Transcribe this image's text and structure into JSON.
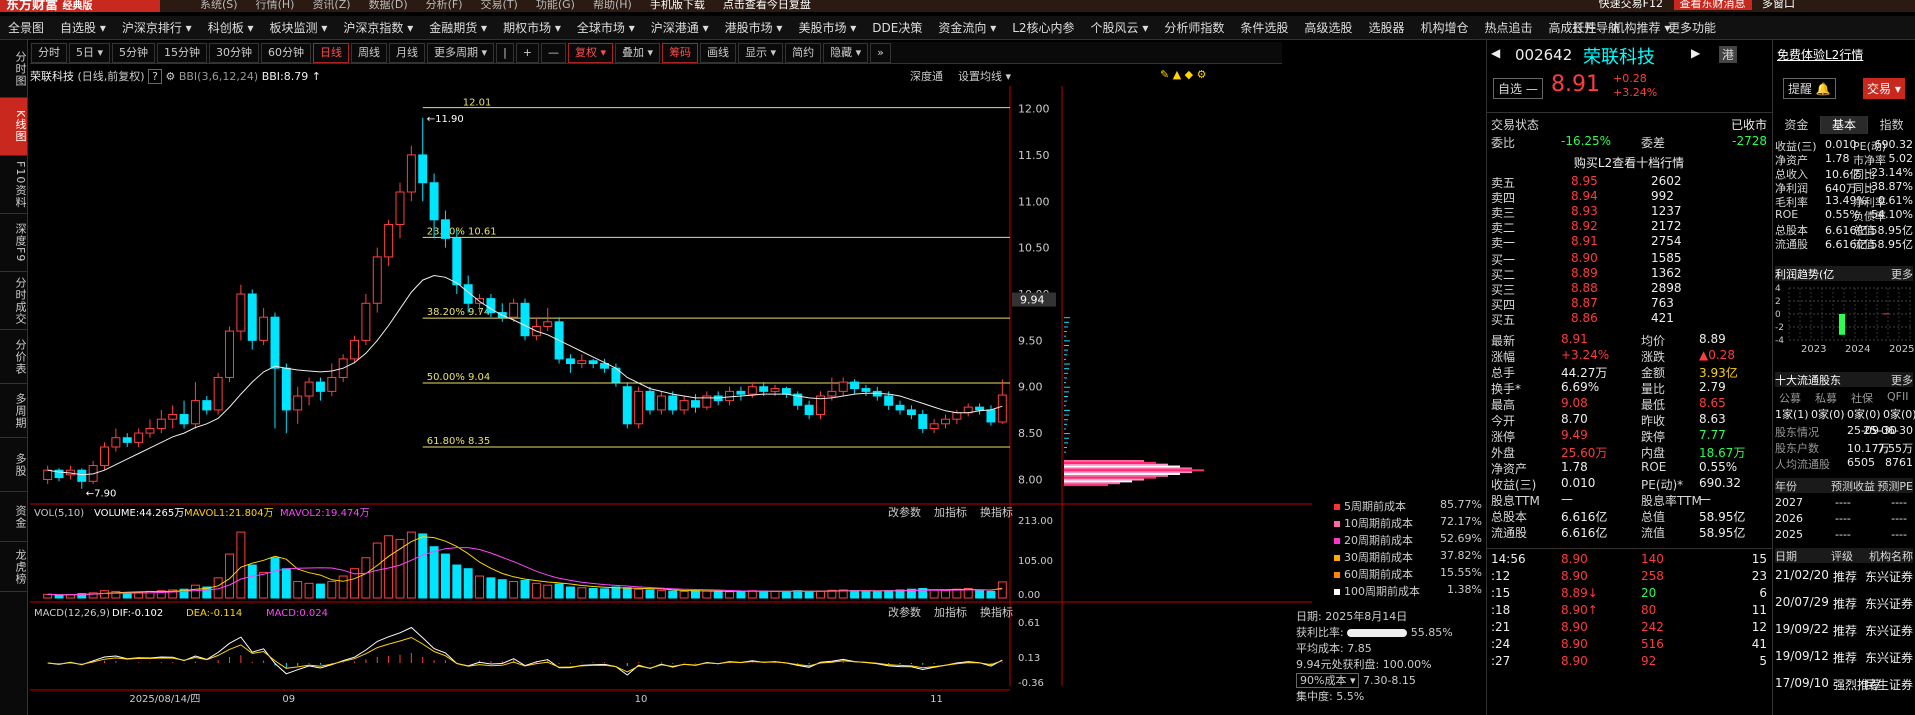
{
  "app": {
    "logo": "东方财富",
    "logo_sub": "经典版",
    "menu": [
      "系统(S)",
      "行情(H)",
      "资讯(Z)",
      "数据(D)",
      "分析(F)",
      "交易(T)",
      "功能(G)",
      "帮助(H)"
    ],
    "ad1": "手机版下载",
    "ad2": "点击查看今日复盘",
    "ad3": "快速交易F12",
    "right": "查看东财消息",
    "right2": "多窗口"
  },
  "nav": {
    "items": [
      "全景图",
      "自选股 ▾",
      "沪深京排行 ▾",
      "科创板 ▾",
      "板块监测 ▾",
      "沪深京指数 ▾",
      "金融期货 ▾",
      "期权市场 ▾",
      "全球市场 ▾",
      "沪深港通 ▾",
      "港股市场 ▾",
      "美股市场 ▾",
      "DDE决策",
      "资金流向 ▾",
      "L2核心内参",
      "个股风云 ▾",
      "分析师指数",
      "条件选股",
      "高级选股",
      "选股器",
      "机构增仓",
      "热点追击",
      "高成长性",
      "机构推荐 ▾",
      "打开导航",
      "更多功能"
    ]
  },
  "side": [
    "分时图",
    "K线图",
    "F10资料",
    "深度F9",
    "分时成交",
    "分价表",
    "多周期",
    "多股",
    "资金",
    "龙虎榜"
  ],
  "toolbar": [
    "分时",
    "5日 ▾",
    "5分钟",
    "15分钟",
    "30分钟",
    "60分钟",
    "日线",
    "周线",
    "月线",
    "更多周期 ▾",
    "|",
    "+",
    "—",
    "复权 ▾",
    "叠加 ▾",
    "筹码",
    "画线",
    "显示 ▾",
    "简约",
    "隐藏 ▾",
    "»"
  ],
  "header": {
    "name": "荣联科技",
    "mode": "(日线,前复权)",
    "help": "?",
    "bbi": "BBI(3,6,12,24)",
    "bbi_val": "BBI:8.79",
    "arrow": "↑",
    "deep": "深度通",
    "settings": "设置均线 ▾"
  },
  "chart_data": {
    "type": "candlestick",
    "ylim": [
      7.8,
      12.2
    ],
    "yticks": [
      "12.00",
      "11.50",
      "11.00",
      "10.50",
      "10.00",
      "9.50",
      "9.00",
      "8.50",
      "8.00"
    ],
    "price_tag": "9.94",
    "fib": [
      {
        "label": "23.60% 10.61",
        "v": 10.61
      },
      {
        "label": "38.20% 9.74",
        "v": 9.74
      },
      {
        "label": "50.00% 9.04",
        "v": 9.04
      },
      {
        "label": "61.80% 8.35",
        "v": 8.35
      }
    ],
    "top_label": "12.01",
    "high_mark": "←11.90",
    "low_mark": "←7.90",
    "candles": [
      [
        8.0,
        8.1,
        7.95,
        8.15
      ],
      [
        8.1,
        8.02,
        7.98,
        8.12
      ],
      [
        8.05,
        8.1,
        8.0,
        8.15
      ],
      [
        8.1,
        7.98,
        7.9,
        8.12
      ],
      [
        7.98,
        8.15,
        7.95,
        8.2
      ],
      [
        8.15,
        8.35,
        8.1,
        8.4
      ],
      [
        8.35,
        8.45,
        8.3,
        8.55
      ],
      [
        8.45,
        8.4,
        8.35,
        8.5
      ],
      [
        8.4,
        8.5,
        8.35,
        8.55
      ],
      [
        8.5,
        8.55,
        8.45,
        8.65
      ],
      [
        8.55,
        8.65,
        8.5,
        8.75
      ],
      [
        8.65,
        8.7,
        8.55,
        8.8
      ],
      [
        8.7,
        8.6,
        8.55,
        8.85
      ],
      [
        8.6,
        8.85,
        8.55,
        9.05
      ],
      [
        8.85,
        8.75,
        8.7,
        8.9
      ],
      [
        8.75,
        9.1,
        8.7,
        9.15
      ],
      [
        9.1,
        9.6,
        9.05,
        9.65
      ],
      [
        9.6,
        10.0,
        9.5,
        10.1
      ],
      [
        10.0,
        9.5,
        9.4,
        10.05
      ],
      [
        9.5,
        9.75,
        9.45,
        9.85
      ],
      [
        9.75,
        9.2,
        8.55,
        9.8
      ],
      [
        9.2,
        8.75,
        8.5,
        9.25
      ],
      [
        8.75,
        8.9,
        8.6,
        9.0
      ],
      [
        8.9,
        9.05,
        8.8,
        9.1
      ],
      [
        9.05,
        8.95,
        8.85,
        9.1
      ],
      [
        8.95,
        9.1,
        8.9,
        9.25
      ],
      [
        9.1,
        9.3,
        9.05,
        9.35
      ],
      [
        9.3,
        9.5,
        9.25,
        9.55
      ],
      [
        9.5,
        9.9,
        9.45,
        10.0
      ],
      [
        9.9,
        10.4,
        9.8,
        10.5
      ],
      [
        10.4,
        10.75,
        10.3,
        10.8
      ],
      [
        10.75,
        11.1,
        10.6,
        11.2
      ],
      [
        11.1,
        11.5,
        11.0,
        11.6
      ],
      [
        11.5,
        11.2,
        11.0,
        11.9
      ],
      [
        11.2,
        10.8,
        10.6,
        11.3
      ],
      [
        10.8,
        10.6,
        10.5,
        10.9
      ],
      [
        10.6,
        10.1,
        10.0,
        10.7
      ],
      [
        10.1,
        9.9,
        9.8,
        10.2
      ],
      [
        9.9,
        9.95,
        9.8,
        10.0
      ],
      [
        9.95,
        9.8,
        9.75,
        10.0
      ],
      [
        9.8,
        9.75,
        9.7,
        9.9
      ],
      [
        9.75,
        9.9,
        9.7,
        9.95
      ],
      [
        9.9,
        9.55,
        9.5,
        9.95
      ],
      [
        9.55,
        9.65,
        9.5,
        9.75
      ],
      [
        9.65,
        9.7,
        9.6,
        9.85
      ],
      [
        9.7,
        9.3,
        9.25,
        9.75
      ],
      [
        9.3,
        9.25,
        9.15,
        9.35
      ],
      [
        9.25,
        9.28,
        9.2,
        9.35
      ],
      [
        9.28,
        9.25,
        9.2,
        9.3
      ],
      [
        9.25,
        9.2,
        9.15,
        9.3
      ],
      [
        9.2,
        9.05,
        9.0,
        9.25
      ],
      [
        9.0,
        8.6,
        8.55,
        9.05
      ],
      [
        8.6,
        8.95,
        8.55,
        9.0
      ],
      [
        8.95,
        8.75,
        8.7,
        9.0
      ],
      [
        8.75,
        8.9,
        8.7,
        8.95
      ],
      [
        8.9,
        8.75,
        8.7,
        8.95
      ],
      [
        8.75,
        8.85,
        8.7,
        8.9
      ],
      [
        8.85,
        8.78,
        8.72,
        8.92
      ],
      [
        8.78,
        8.9,
        8.75,
        8.95
      ],
      [
        8.9,
        8.85,
        8.8,
        8.95
      ],
      [
        8.85,
        8.95,
        8.8,
        9.0
      ],
      [
        8.95,
        8.92,
        8.85,
        9.0
      ],
      [
        8.92,
        9.0,
        8.88,
        9.05
      ],
      [
        9.0,
        8.95,
        8.9,
        9.05
      ],
      [
        8.95,
        8.98,
        8.9,
        9.02
      ],
      [
        8.98,
        8.92,
        8.88,
        9.0
      ],
      [
        8.92,
        8.8,
        8.75,
        8.95
      ],
      [
        8.8,
        8.7,
        8.65,
        8.85
      ],
      [
        8.7,
        8.9,
        8.65,
        8.95
      ],
      [
        8.9,
        8.95,
        8.85,
        9.1
      ],
      [
        8.95,
        9.05,
        8.9,
        9.1
      ],
      [
        9.05,
        8.98,
        8.92,
        9.08
      ],
      [
        8.98,
        8.95,
        8.9,
        9.02
      ],
      [
        8.95,
        8.9,
        8.85,
        9.0
      ],
      [
        8.9,
        8.8,
        8.75,
        8.95
      ],
      [
        8.8,
        8.75,
        8.7,
        8.85
      ],
      [
        8.75,
        8.7,
        8.65,
        8.8
      ],
      [
        8.7,
        8.55,
        8.5,
        8.75
      ],
      [
        8.55,
        8.6,
        8.5,
        8.65
      ],
      [
        8.6,
        8.65,
        8.55,
        8.7
      ],
      [
        8.65,
        8.72,
        8.6,
        8.75
      ],
      [
        8.72,
        8.78,
        8.68,
        8.82
      ],
      [
        8.78,
        8.75,
        8.7,
        8.82
      ],
      [
        8.75,
        8.62,
        8.58,
        8.8
      ],
      [
        8.62,
        8.91,
        8.6,
        9.08
      ]
    ],
    "bbi": [
      8.1,
      8.08,
      8.07,
      8.05,
      8.06,
      8.1,
      8.16,
      8.22,
      8.28,
      8.34,
      8.4,
      8.46,
      8.5,
      8.56,
      8.6,
      8.66,
      8.78,
      8.92,
      9.05,
      9.16,
      9.22,
      9.2,
      9.18,
      9.17,
      9.16,
      9.17,
      9.2,
      9.26,
      9.36,
      9.5,
      9.66,
      9.84,
      10.02,
      10.15,
      10.2,
      10.18,
      10.12,
      10.02,
      9.92,
      9.84,
      9.77,
      9.72,
      9.66,
      9.6,
      9.56,
      9.5,
      9.44,
      9.38,
      9.32,
      9.26,
      9.2,
      9.1,
      9.04,
      8.98,
      8.95,
      8.92,
      8.9,
      8.88,
      8.88,
      8.88,
      8.89,
      8.9,
      8.91,
      8.92,
      8.92,
      8.92,
      8.9,
      8.88,
      8.87,
      8.88,
      8.9,
      8.92,
      8.93,
      8.93,
      8.92,
      8.9,
      8.86,
      8.82,
      8.78,
      8.74,
      8.72,
      8.72,
      8.74,
      8.75,
      8.79
    ],
    "vol": {
      "title": "VOL(5,10)",
      "volume": "VOLUME:44.265万",
      "mavol1": "MAVOL1:21.804万",
      "mavol2": "MAVOL2:19.474万",
      "ticks": [
        "213.00",
        "105.00",
        "0.00"
      ],
      "max": 213,
      "values": [
        10,
        8,
        9,
        12,
        14,
        20,
        18,
        15,
        16,
        18,
        20,
        22,
        24,
        35,
        30,
        55,
        120,
        180,
        90,
        70,
        110,
        80,
        45,
        40,
        38,
        45,
        60,
        80,
        110,
        150,
        170,
        160,
        180,
        175,
        140,
        120,
        90,
        80,
        60,
        55,
        50,
        45,
        48,
        40,
        35,
        38,
        30,
        28,
        26,
        25,
        30,
        28,
        24,
        22,
        20,
        19,
        18,
        20,
        19,
        18,
        17,
        18,
        20,
        19,
        18,
        17,
        20,
        18,
        19,
        21,
        22,
        20,
        19,
        18,
        20,
        22,
        24,
        26,
        22,
        20,
        24,
        26,
        20,
        18,
        44
      ]
    },
    "macd": {
      "title": "MACD(12,26,9)",
      "dif": "DIF:-0.102",
      "dea": "DEA:-0.114",
      "macd": "MACD:0.024",
      "ticks": [
        "0.61",
        "0.13",
        "-0.36"
      ]
    },
    "xlabels": [
      {
        "t": "2025/08/14/四",
        "i": 10
      },
      {
        "t": "09",
        "i": 21
      },
      {
        "t": "10",
        "i": 52
      },
      {
        "t": "11",
        "i": 78
      }
    ]
  },
  "vol_btns": [
    "改参数",
    "加指标",
    "换指标"
  ],
  "legend": [
    {
      "name": "5周期前成本",
      "pct": "85.77%",
      "color": "#ff3030"
    },
    {
      "name": "10周期前成本",
      "pct": "72.17%",
      "color": "#ff66aa"
    },
    {
      "name": "20周期前成本",
      "pct": "52.69%",
      "color": "#ff33cc"
    },
    {
      "name": "30周期前成本",
      "pct": "37.82%",
      "color": "#ffaa00"
    },
    {
      "name": "60周期前成本",
      "pct": "15.55%",
      "color": "#ff8800"
    },
    {
      "name": "100周期前成本",
      "pct": "1.38%",
      "color": "#ffffff"
    }
  ],
  "chip": {
    "date": "日期: 2025年8月14日",
    "profit": "获利比率:",
    "profit_pct": "55.85%",
    "avg": "平均成本: 7.85",
    "pan": "9.94元处获利盘: 100.00%",
    "cost": "90%成本 ▾",
    "range": "7.30-8.15",
    "conc": "集中度: 5.5%"
  },
  "quote": {
    "code": "002642",
    "name": "荣联科技",
    "tag": "港",
    "free": "免费体验L2行情",
    "price": "8.91",
    "chg": "+0.28",
    "pct": "+3.24%",
    "btn_sel": "自选 —",
    "btn_warn": "提醒 🔔",
    "btn_trade": "交易 ▾",
    "status_label": "交易状态",
    "status": "已收市",
    "wb_l": "委比",
    "wb": "-16.25%",
    "wc_l": "委差",
    "wc": "-2728",
    "l2": "购买L2查看十档行情",
    "asks": [
      [
        "卖五",
        "8.95",
        "2602"
      ],
      [
        "卖四",
        "8.94",
        "992"
      ],
      [
        "卖三",
        "8.93",
        "1237"
      ],
      [
        "卖二",
        "8.92",
        "2172"
      ],
      [
        "卖一",
        "8.91",
        "2754"
      ]
    ],
    "bids": [
      [
        "买一",
        "8.90",
        "1585"
      ],
      [
        "买二",
        "8.89",
        "1362"
      ],
      [
        "买三",
        "8.88",
        "2898"
      ],
      [
        "买四",
        "8.87",
        "763"
      ],
      [
        "买五",
        "8.86",
        "421"
      ]
    ],
    "stats": [
      [
        "最新",
        "8.91",
        "均价",
        "8.89"
      ],
      [
        "涨幅",
        "+3.24%",
        "涨跌",
        "▲0.28"
      ],
      [
        "总手",
        "44.27万",
        "金额",
        "3.93亿"
      ],
      [
        "换手*",
        "6.69%",
        "量比",
        "2.79"
      ],
      [
        "最高",
        "9.08",
        "最低",
        "8.65"
      ],
      [
        "今开",
        "8.70",
        "昨收",
        "8.63"
      ],
      [
        "涨停",
        "9.49",
        "跌停",
        "7.77"
      ],
      [
        "外盘",
        "25.60万",
        "内盘",
        "18.67万"
      ],
      [
        "净资产",
        "1.78",
        "ROE",
        "0.55%"
      ],
      [
        "收益(三)",
        "0.010",
        "PE(动)*",
        "690.32"
      ],
      [
        "股息TTM",
        "—",
        "股息率TTM",
        "—"
      ],
      [
        "总股本",
        "6.616亿",
        "总值",
        "58.95亿"
      ],
      [
        "流通股",
        "6.616亿",
        "流值",
        "58.95亿"
      ]
    ],
    "ticks": [
      [
        "14:56",
        "8.90",
        "140",
        "15"
      ],
      [
        ":12",
        "8.90",
        "258",
        "23"
      ],
      [
        ":15",
        "8.89↓",
        "20",
        "6"
      ],
      [
        ":18",
        "8.90↑",
        "80",
        "11"
      ],
      [
        ":21",
        "8.90",
        "242",
        "12"
      ],
      [
        ":24",
        "8.90",
        "516",
        "41"
      ],
      [
        ":27",
        "8.90",
        "92",
        "5"
      ]
    ]
  },
  "f10": {
    "tabs": [
      "资金",
      "基本",
      "指数"
    ],
    "rows": [
      [
        "收益(三)",
        "0.010",
        "PE(动)",
        "690.32"
      ],
      [
        "净资产",
        "1.78",
        "市净率",
        "5.02"
      ],
      [
        "总收入",
        "10.6亿",
        "同比",
        "-23.14%"
      ],
      [
        "净利润",
        "640万",
        "同比",
        "-38.87%"
      ],
      [
        "毛利率",
        "13.49%",
        "净利率",
        "0.61%"
      ],
      [
        "ROE",
        "0.55%",
        "负债率",
        "54.10%"
      ],
      [
        "总股本",
        "6.616亿",
        "总值",
        "58.95亿"
      ],
      [
        "流通股",
        "6.616亿",
        "流值",
        "58.95亿"
      ]
    ],
    "trend_title": "利润趋势(亿",
    "more": "更多",
    "trend_years": [
      "2023",
      "2024",
      "2025"
    ],
    "trend_ticks": [
      "4",
      "2",
      "0",
      "-2",
      "-4"
    ],
    "trend_values": [
      -3.2,
      0.1,
      0.05
    ],
    "holders_title": "十大流通股东",
    "holders_hdr": [
      "公募",
      "私募",
      "社保",
      "QFII"
    ],
    "holders_vals": [
      "1家(1)",
      "0家(0)",
      "0家(0)",
      "0家(0)"
    ],
    "holder_rows": [
      [
        "股东情况",
        "25-09-30",
        "25-06-30"
      ],
      [
        "股东户数",
        "10.17万",
        "7.55万"
      ],
      [
        "人均流通股",
        "6505",
        "8761"
      ]
    ],
    "pe_hdr": [
      "年份",
      "预测收益",
      "预测PE"
    ],
    "pe_rows": [
      [
        "2027",
        "----",
        "----"
      ],
      [
        "2026",
        "----",
        "----"
      ],
      [
        "2025",
        "----",
        "----"
      ]
    ],
    "rate_hdr": [
      "日期",
      "评级",
      "机构名称"
    ],
    "rate_rows": [
      [
        "21/02/20",
        "推荐",
        "东兴证券"
      ],
      [
        "20/07/29",
        "推荐",
        "东兴证券"
      ],
      [
        "19/09/22",
        "推荐",
        "东兴证券"
      ],
      [
        "19/09/12",
        "推荐",
        "东兴证券"
      ],
      [
        "17/09/10",
        "强烈推荐",
        "民生证券"
      ]
    ]
  }
}
